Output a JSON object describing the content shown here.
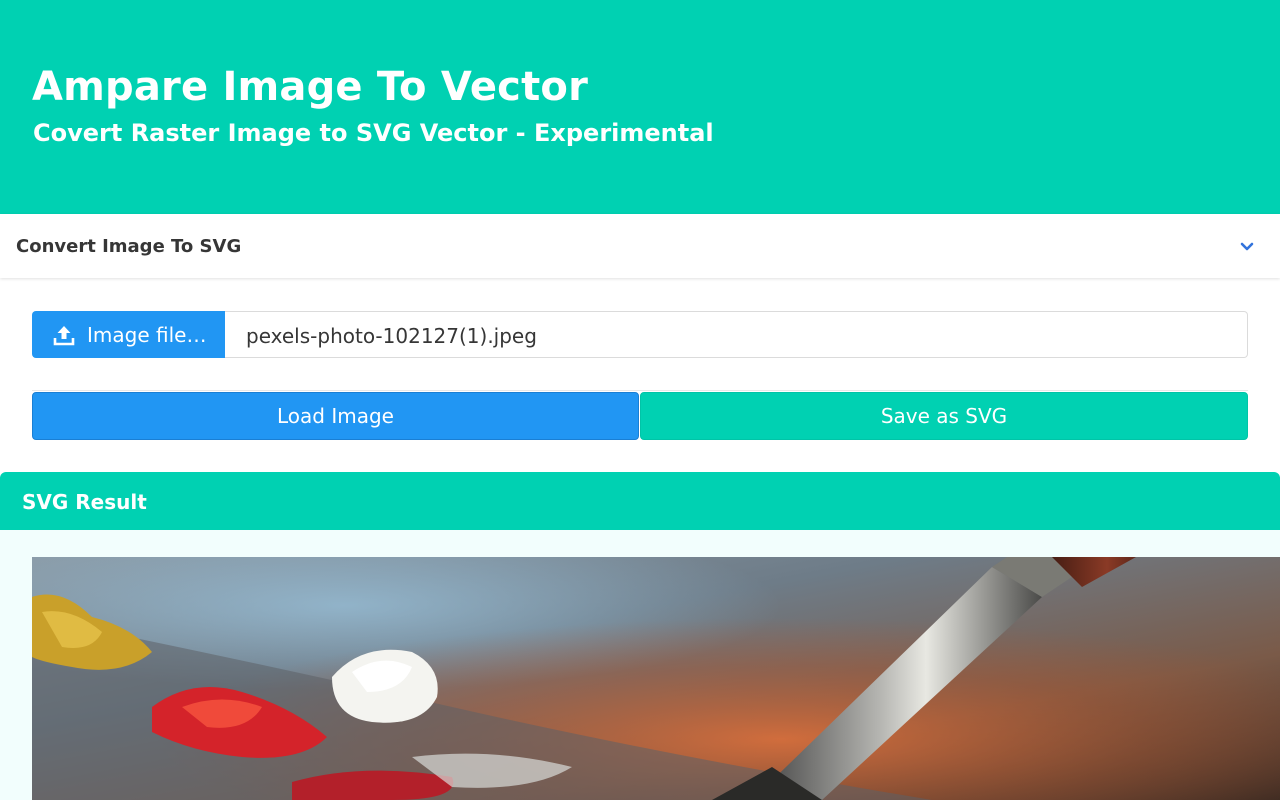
{
  "hero": {
    "title": "Ampare Image To Vector",
    "subtitle": "Covert Raster Image to SVG Vector - Experimental"
  },
  "converter": {
    "title": "Convert Image To SVG",
    "collapse_icon": "chevron-down-icon",
    "file_input": {
      "button_label": "Image file…",
      "button_icon": "upload-icon",
      "file_name": "pexels-photo-102127(1).jpeg"
    },
    "load_button_label": "Load Image",
    "save_button_label": "Save as SVG"
  },
  "result": {
    "title": "SVG Result",
    "image_subject": "paint palette with oil paints and brush"
  },
  "colors": {
    "primary_teal": "#00d1b2",
    "info_blue": "#2196f3",
    "text_dark": "#363636",
    "result_bg": "#f2fefd"
  }
}
